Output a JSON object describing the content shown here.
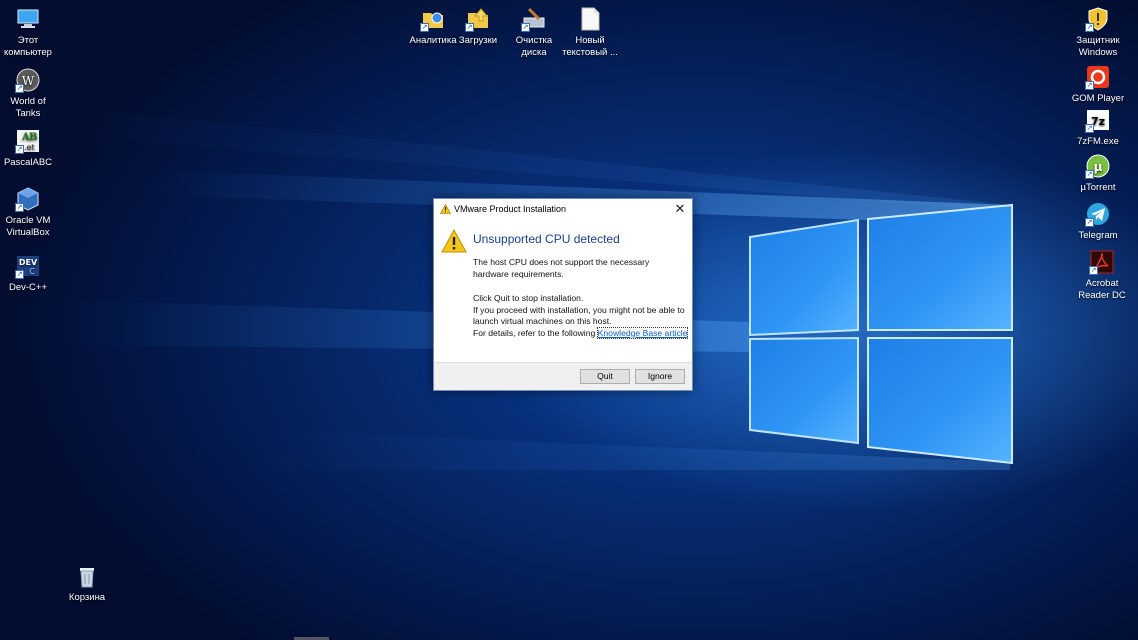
{
  "desktop_icons_left": [
    {
      "name": "this-pc-icon",
      "label": "Этот\nкомпьютер"
    },
    {
      "name": "world-of-tanks-icon",
      "label": "World of\nTanks"
    },
    {
      "name": "pascalabc-icon",
      "label": "PascalABC"
    },
    {
      "name": "virtualbox-icon",
      "label": "Oracle VM\nVirtualBox"
    },
    {
      "name": "dev-cpp-icon",
      "label": "Dev-C++"
    },
    {
      "name": "recycle-bin-icon",
      "label": "Корзина"
    }
  ],
  "desktop_icons_top": [
    {
      "name": "analytics-icon",
      "label": "Аналитика"
    },
    {
      "name": "downloads-icon",
      "label": "Загрузки"
    },
    {
      "name": "disk-cleanup-icon",
      "label": "Очистка\nдиска"
    },
    {
      "name": "new-text-doc-icon",
      "label": "Новый\nтекстовый ..."
    }
  ],
  "desktop_icons_right": [
    {
      "name": "windows-defender-icon",
      "label": "Защитник\nWindows"
    },
    {
      "name": "gom-player-icon",
      "label": "GOM Player"
    },
    {
      "name": "7zfm-icon",
      "label": "7zFM.exe"
    },
    {
      "name": "utorrent-icon",
      "label": "µTorrent"
    },
    {
      "name": "telegram-icon",
      "label": "Telegram"
    },
    {
      "name": "acrobat-icon",
      "label": "Acrobat\nReader DC"
    }
  ],
  "dialog": {
    "title": "VMware Product Installation",
    "close_glyph": "✕",
    "heading": "Unsupported CPU detected",
    "para1": "The host CPU does not support the necessary hardware requirements.",
    "para2_line1": "Click Quit to stop installation.",
    "para2_line2": "If you proceed with installation, you might not be able to launch virtual machines on this host.",
    "para2_line3_prefix": "For details, refer to the following ",
    "link_text": "Knowledge Base article",
    "quit_label": "Quit",
    "ignore_label": "Ignore"
  },
  "colors": {
    "heading": "#1b3f8f",
    "link": "#0a5fc4",
    "warning": "#f5c518"
  }
}
